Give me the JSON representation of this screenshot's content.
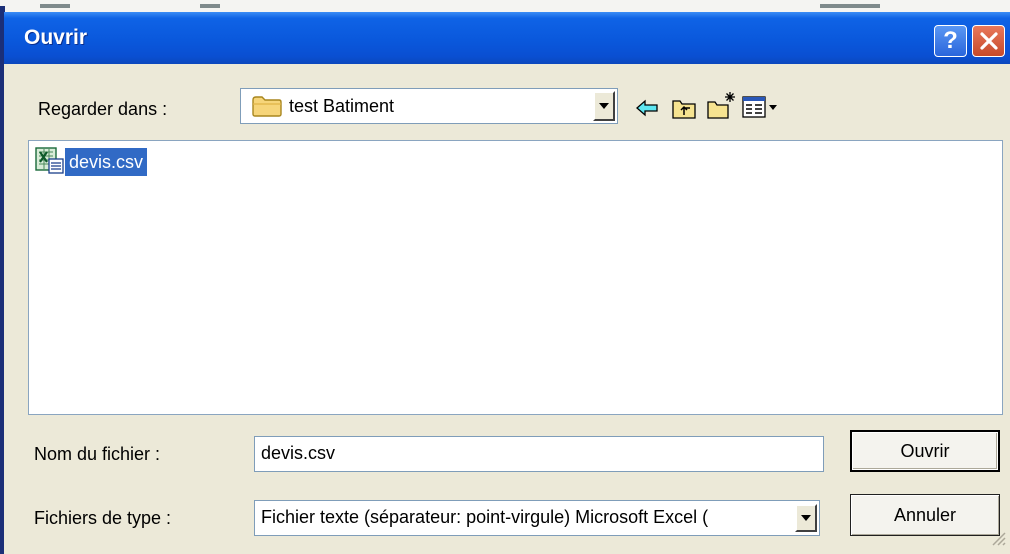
{
  "window": {
    "title": "Ouvrir",
    "help_label": "?",
    "close_label": "✕"
  },
  "look_in": {
    "label": "Regarder dans :",
    "value": "test Batiment",
    "icon": "folder-icon"
  },
  "toolbar": {
    "icons": [
      "back-arrow-icon",
      "up-folder-icon",
      "new-folder-icon",
      "view-menu-icon"
    ]
  },
  "file_list": {
    "items": [
      {
        "name": "devis.csv",
        "icon": "excel-file-icon",
        "selected": true
      }
    ]
  },
  "filename": {
    "label": "Nom du fichier :",
    "value": "devis.csv"
  },
  "filetype": {
    "label": "Fichiers de type :",
    "value": "Fichier texte (séparateur: point-virgule) Microsoft Excel ("
  },
  "buttons": {
    "open_label": "Ouvrir",
    "cancel_label": "Annuler"
  },
  "colors": {
    "titlebar": "#0a58dc",
    "dialog_bg": "#ece9d8",
    "selection": "#316ac5"
  }
}
